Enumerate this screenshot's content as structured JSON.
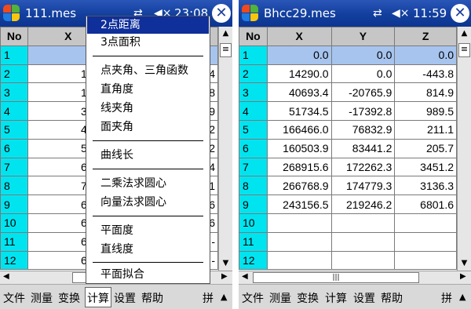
{
  "left": {
    "title": "111.mes",
    "clock": "23:08",
    "columns": [
      "No",
      "X",
      "",
      ""
    ],
    "rows": [
      {
        "no": "1",
        "x": "192",
        "b": "",
        "c": ""
      },
      {
        "no": "2",
        "x": "1330",
        "b": "",
        "c": "4"
      },
      {
        "no": "3",
        "x": "1942",
        "b": "",
        "c": "8"
      },
      {
        "no": "4",
        "x": "3930",
        "b": "",
        "c": "9"
      },
      {
        "no": "5",
        "x": "4564",
        "b": "",
        "c": "2"
      },
      {
        "no": "6",
        "x": "5500",
        "b": "",
        "c": "2"
      },
      {
        "no": "7",
        "x": "6870",
        "b": "",
        "c": "4"
      },
      {
        "no": "8",
        "x": "7986",
        "b": "",
        "c": "1"
      },
      {
        "no": "9",
        "x": "6886",
        "b": "",
        "c": "6"
      },
      {
        "no": "10",
        "x": "6550",
        "b": "",
        "c": "6"
      },
      {
        "no": "11",
        "x": "6358",
        "b": "",
        "c": "-"
      },
      {
        "no": "12",
        "x": "6316",
        "b": "",
        "c": "-"
      }
    ],
    "menu": [
      "文件",
      "测量",
      "变换",
      "计算",
      "设置",
      "帮助"
    ],
    "active_menu": "计算",
    "ime": "拼",
    "dropdown": [
      {
        "label": "2点距离",
        "highlight": true
      },
      {
        "label": "3点面积"
      },
      {
        "label": "点夹角、三角函数"
      },
      {
        "label": "直角度"
      },
      {
        "label": "线夹角"
      },
      {
        "label": "面夹角"
      },
      {
        "label": "曲线长"
      },
      {
        "label": "二乘法求圆心"
      },
      {
        "label": "向量法求圆心"
      },
      {
        "label": "平面度"
      },
      {
        "label": "直线度"
      },
      {
        "label": "平面拟合"
      }
    ]
  },
  "right": {
    "title": "Bhcc29.mes",
    "clock": "11:59",
    "columns": [
      "No",
      "X",
      "Y",
      "Z"
    ],
    "rows": [
      {
        "no": "1",
        "x": "0.0",
        "y": "0.0",
        "z": "0.0"
      },
      {
        "no": "2",
        "x": "14290.0",
        "y": "0.0",
        "z": "-443.8"
      },
      {
        "no": "3",
        "x": "40693.4",
        "y": "-20765.9",
        "z": "814.9"
      },
      {
        "no": "4",
        "x": "51734.5",
        "y": "-17392.8",
        "z": "989.5"
      },
      {
        "no": "5",
        "x": "166466.0",
        "y": "76832.9",
        "z": "211.1"
      },
      {
        "no": "6",
        "x": "160503.9",
        "y": "83441.2",
        "z": "205.7"
      },
      {
        "no": "7",
        "x": "268915.6",
        "y": "172262.3",
        "z": "3451.2"
      },
      {
        "no": "8",
        "x": "266768.9",
        "y": "174779.3",
        "z": "3136.3"
      },
      {
        "no": "9",
        "x": "243156.5",
        "y": "219246.2",
        "z": "6801.6"
      },
      {
        "no": "10",
        "x": "",
        "y": "",
        "z": ""
      },
      {
        "no": "11",
        "x": "",
        "y": "",
        "z": ""
      },
      {
        "no": "12",
        "x": "",
        "y": "",
        "z": ""
      }
    ],
    "menu": [
      "文件",
      "测量",
      "变换",
      "计算",
      "设置",
      "帮助"
    ],
    "ime": "拼"
  },
  "icons": [
    "windows-start-icon",
    "sync-arrows-icon",
    "speaker-muted-icon",
    "close-icon"
  ],
  "colors": {
    "titlebar": "#123f9e",
    "row_number_cell": "#00e4f0",
    "header_cell": "#c6c6c6",
    "selected_row": "#a6c4ee",
    "menu_highlight": "#0f2f9a"
  }
}
